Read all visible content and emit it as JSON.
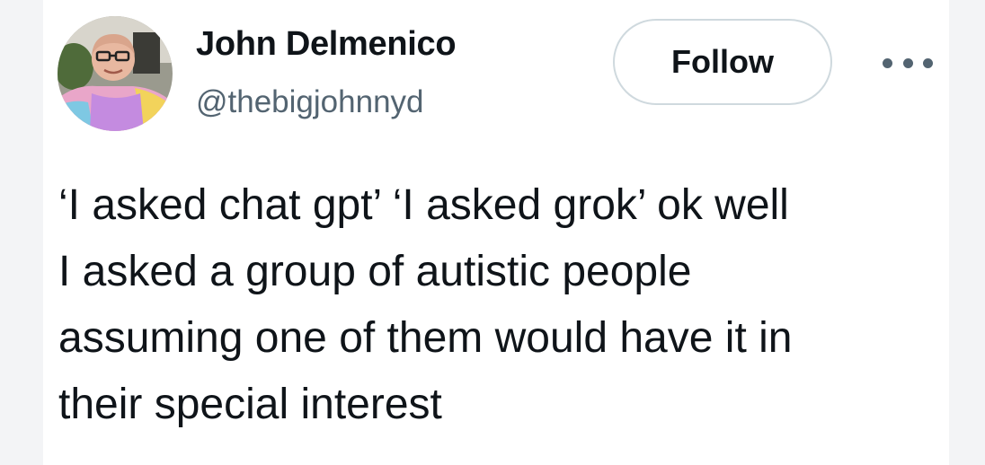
{
  "tweet": {
    "author": {
      "display_name": "John Delmenico",
      "handle": "@thebigjohnnyd",
      "avatar_icon": "profile-photo"
    },
    "follow_label": "Follow",
    "more_icon": "more-horizontal-icon",
    "text": "‘I asked chat gpt’ ‘I asked grok’ ok well\nI asked a group of autistic people\nassuming one of them would have it in\ntheir special interest"
  },
  "colors": {
    "text_primary": "#0f1419",
    "text_secondary": "#536471",
    "follow_border": "#cfd9de",
    "page_background": "#f3f4f6",
    "card_background": "#ffffff"
  }
}
